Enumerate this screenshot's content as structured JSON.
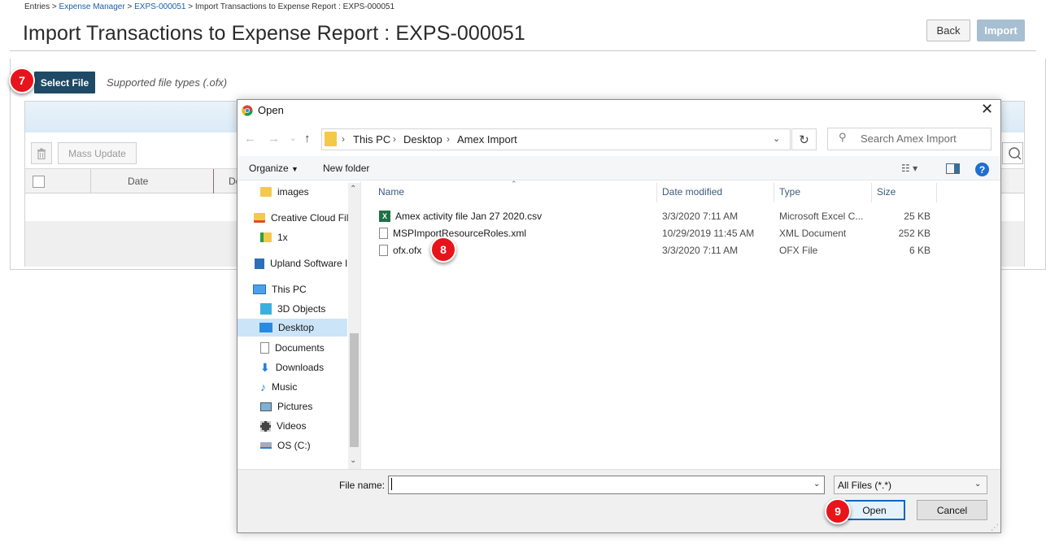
{
  "breadcrumb": {
    "prefix": "Entries >",
    "link1": "Expense Manager",
    "sep1": ">",
    "link2": "EXPS-000051",
    "current": "> Import Transactions to Expense Report : EXPS-000051"
  },
  "page": {
    "title": "Import Transactions to Expense Report : EXPS-000051",
    "back_label": "Back",
    "import_label": "Import",
    "select_file_label": "Select File",
    "supported_types": "Supported file types (.ofx)",
    "mass_update_label": "Mass Update",
    "col_date": "Date",
    "col_de": "De"
  },
  "steps": {
    "s7": "7",
    "s8": "8",
    "s9": "9"
  },
  "dialog": {
    "title": "Open",
    "address": [
      "This PC",
      "Desktop",
      "Amex Import"
    ],
    "search_placeholder": "Search Amex Import",
    "organize_label": "Organize",
    "new_folder_label": "New folder",
    "nav_items": [
      {
        "label": "images",
        "icon": "folder-icon"
      },
      {
        "label": "Creative Cloud Fil",
        "icon": "creative-cloud-icon"
      },
      {
        "label": "1x",
        "icon": "folder-icon"
      },
      {
        "label": "Upland Software I",
        "icon": "building-icon"
      },
      {
        "label": "This PC",
        "icon": "computer-icon"
      },
      {
        "label": "3D Objects",
        "icon": "cube-icon"
      },
      {
        "label": "Desktop",
        "icon": "desktop-icon"
      },
      {
        "label": "Documents",
        "icon": "document-icon"
      },
      {
        "label": "Downloads",
        "icon": "download-icon"
      },
      {
        "label": "Music",
        "icon": "music-icon"
      },
      {
        "label": "Pictures",
        "icon": "picture-icon"
      },
      {
        "label": "Videos",
        "icon": "video-icon"
      },
      {
        "label": "OS (C:)",
        "icon": "drive-icon"
      }
    ],
    "columns": {
      "name": "Name",
      "date": "Date modified",
      "type": "Type",
      "size": "Size"
    },
    "files": [
      {
        "name": "Amex activity file Jan 27 2020.csv",
        "date": "3/3/2020 7:11 AM",
        "type": "Microsoft Excel C...",
        "size": "25 KB"
      },
      {
        "name": "MSPImportResourceRoles.xml",
        "date": "10/29/2019 11:45 AM",
        "type": "XML Document",
        "size": "252 KB"
      },
      {
        "name": "ofx.ofx",
        "date": "3/3/2020 7:11 AM",
        "type": "OFX File",
        "size": "6 KB"
      }
    ],
    "file_name_label": "File name:",
    "file_name_value": "",
    "file_type": "All Files (*.*)",
    "open_label": "Open",
    "cancel_label": "Cancel"
  },
  "colors": {
    "select_file_bg": "#1e4a66",
    "import_bg": "#a7bfd0",
    "badge": "#e8141b",
    "selection": "#cce4f7",
    "link": "#1a5fa8"
  }
}
